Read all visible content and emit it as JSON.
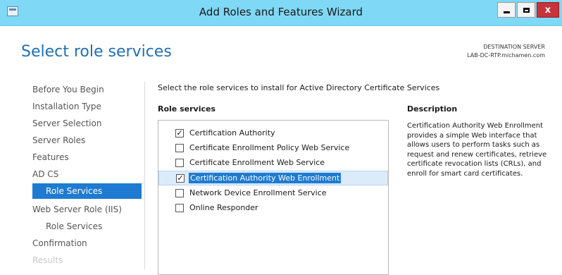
{
  "window": {
    "title": "Add Roles and Features Wizard",
    "minimize_glyph": "",
    "close_glyph": "x"
  },
  "header": {
    "page_title": "Select role services",
    "destination_label": "DESTINATION SERVER",
    "destination_server": "LAB-DC-RTP.michamen.com"
  },
  "nav": {
    "items": [
      {
        "label": "Before You Begin"
      },
      {
        "label": "Installation Type"
      },
      {
        "label": "Server Selection"
      },
      {
        "label": "Server Roles"
      },
      {
        "label": "Features"
      },
      {
        "label": "AD CS"
      },
      {
        "label": "Role Services",
        "active": true
      },
      {
        "label": "Web Server Role (IIS)"
      },
      {
        "label": "Role Services"
      },
      {
        "label": "Confirmation"
      },
      {
        "label": "Results",
        "disabled": true
      }
    ]
  },
  "main": {
    "instruction": "Select the role services to install for Active Directory Certificate Services",
    "role_services_header": "Role services",
    "description_header": "Description",
    "role_services": [
      {
        "label": "Certification Authority",
        "checked": true
      },
      {
        "label": "Certificate Enrollment Policy Web Service",
        "checked": false
      },
      {
        "label": "Certificate Enrollment Web Service",
        "checked": false
      },
      {
        "label": "Certification Authority Web Enrollment",
        "checked": true,
        "selected": true
      },
      {
        "label": "Network Device Enrollment Service",
        "checked": false
      },
      {
        "label": "Online Responder",
        "checked": false
      }
    ],
    "description": "Certification Authority Web Enrollment provides a simple Web interface that allows users to perform tasks such as request and renew certificates, retrieve certificate revocation lists (CRLs), and enroll for smart card certificates.",
    "check_glyph": "✓"
  },
  "colors": {
    "titlebar": "#7fd8f5",
    "accent": "#1e7bd1",
    "title_blue": "#1f6fb3",
    "close_red": "#c7343a"
  }
}
